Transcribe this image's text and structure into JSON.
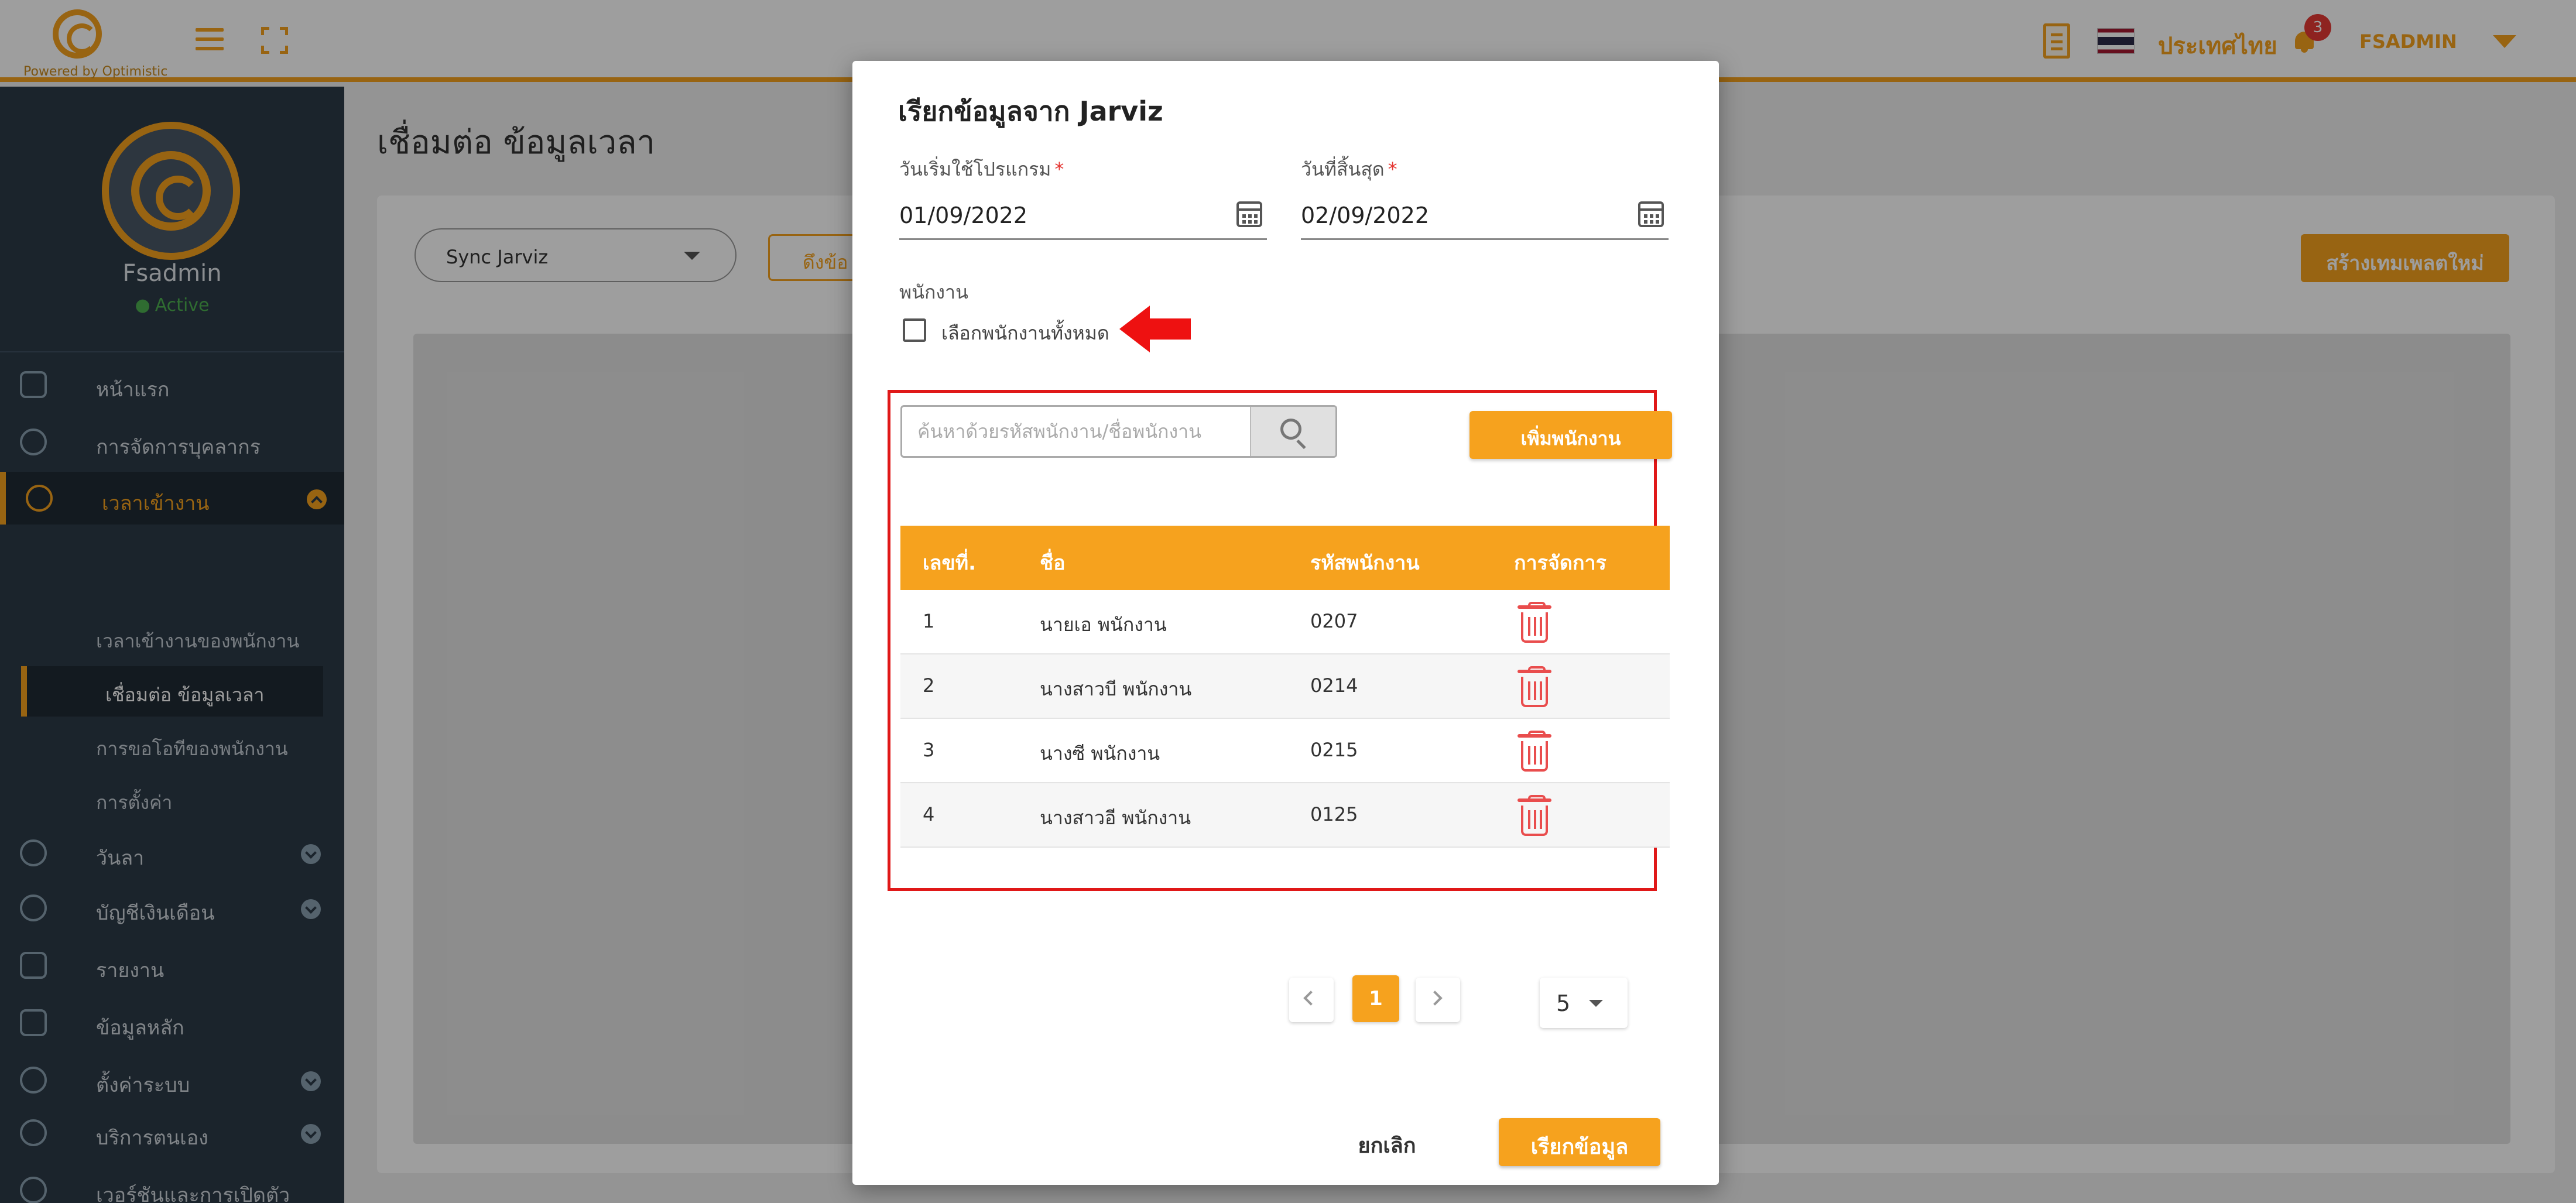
{
  "header": {
    "powered_by": "Powered by Optimistic",
    "language": "ประเทศไทย",
    "notification_count": "3",
    "username": "FSADMIN",
    "accent_color": "#f6a21e"
  },
  "sidebar": {
    "user_name": "Fsadmin",
    "user_status": "Active",
    "items": [
      {
        "label": "หน้าแรก",
        "icon": "home-icon"
      },
      {
        "label": "การจัดการบุคลากร",
        "icon": "people-icon"
      },
      {
        "label": "เวลาเข้างาน",
        "icon": "clock-icon"
      },
      {
        "label": "วันลา",
        "icon": "calendar-clock-icon"
      },
      {
        "label": "บัญชีเงินเดือน",
        "icon": "money-icon"
      },
      {
        "label": "รายงาน",
        "icon": "report-icon"
      },
      {
        "label": "ข้อมูลหลัก",
        "icon": "database-icon"
      },
      {
        "label": "ตั้งค่าระบบ",
        "icon": "gear-icon"
      },
      {
        "label": "บริการตนเอง",
        "icon": "user-icon"
      },
      {
        "label": "เวอร์ชันและการเปิดตัว",
        "icon": "version-icon"
      }
    ],
    "sub_items": [
      {
        "label": "เวลาเข้างานของพนักงาน"
      },
      {
        "label": "เชื่อมต่อ ข้อมูลเวลา"
      },
      {
        "label": "การขอโอทีของพนักงาน"
      },
      {
        "label": "การตั้งค่า"
      }
    ]
  },
  "main": {
    "page_title": "เชื่อมต่อ ข้อมูลเวลา",
    "sync_select_value": "Sync Jarviz",
    "pull_button": "ดึงข้อ",
    "create_template_button": "สร้างเทมเพลตใหม่"
  },
  "modal": {
    "title": "เรียกข้อมูลจาก Jarviz",
    "start_label": "วันเริ่มใช้โปรแกรม",
    "end_label": "วันที่สิ้นสุด",
    "required_mark": "*",
    "start_date": "01/09/2022",
    "end_date": "02/09/2022",
    "employee_label": "พนักงาน",
    "select_all_label": "เลือกพนักงานทั้งหมด",
    "search_placeholder": "ค้นหาด้วยรหัสพนักงาน/ชื่อพนักงาน",
    "add_employee_button": "เพิ่มพนักงาน",
    "table": {
      "headers": [
        "เลขที่.",
        "ชื่อ",
        "รหัสพนักงาน",
        "การจัดการ"
      ],
      "rows": [
        {
          "no": "1",
          "name": "นายเอ พนักงาน",
          "code": "0207"
        },
        {
          "no": "2",
          "name": "นางสาวบี พนักงาน",
          "code": "0214"
        },
        {
          "no": "3",
          "name": "นางซี พนักงาน",
          "code": "0215"
        },
        {
          "no": "4",
          "name": "นางสาวอี พนักงาน",
          "code": "0125"
        }
      ]
    },
    "pagination": {
      "current_page": "1",
      "page_size": "5"
    },
    "cancel_button": "ยกเลิก",
    "fetch_button": "เรียกข้อมูล"
  }
}
